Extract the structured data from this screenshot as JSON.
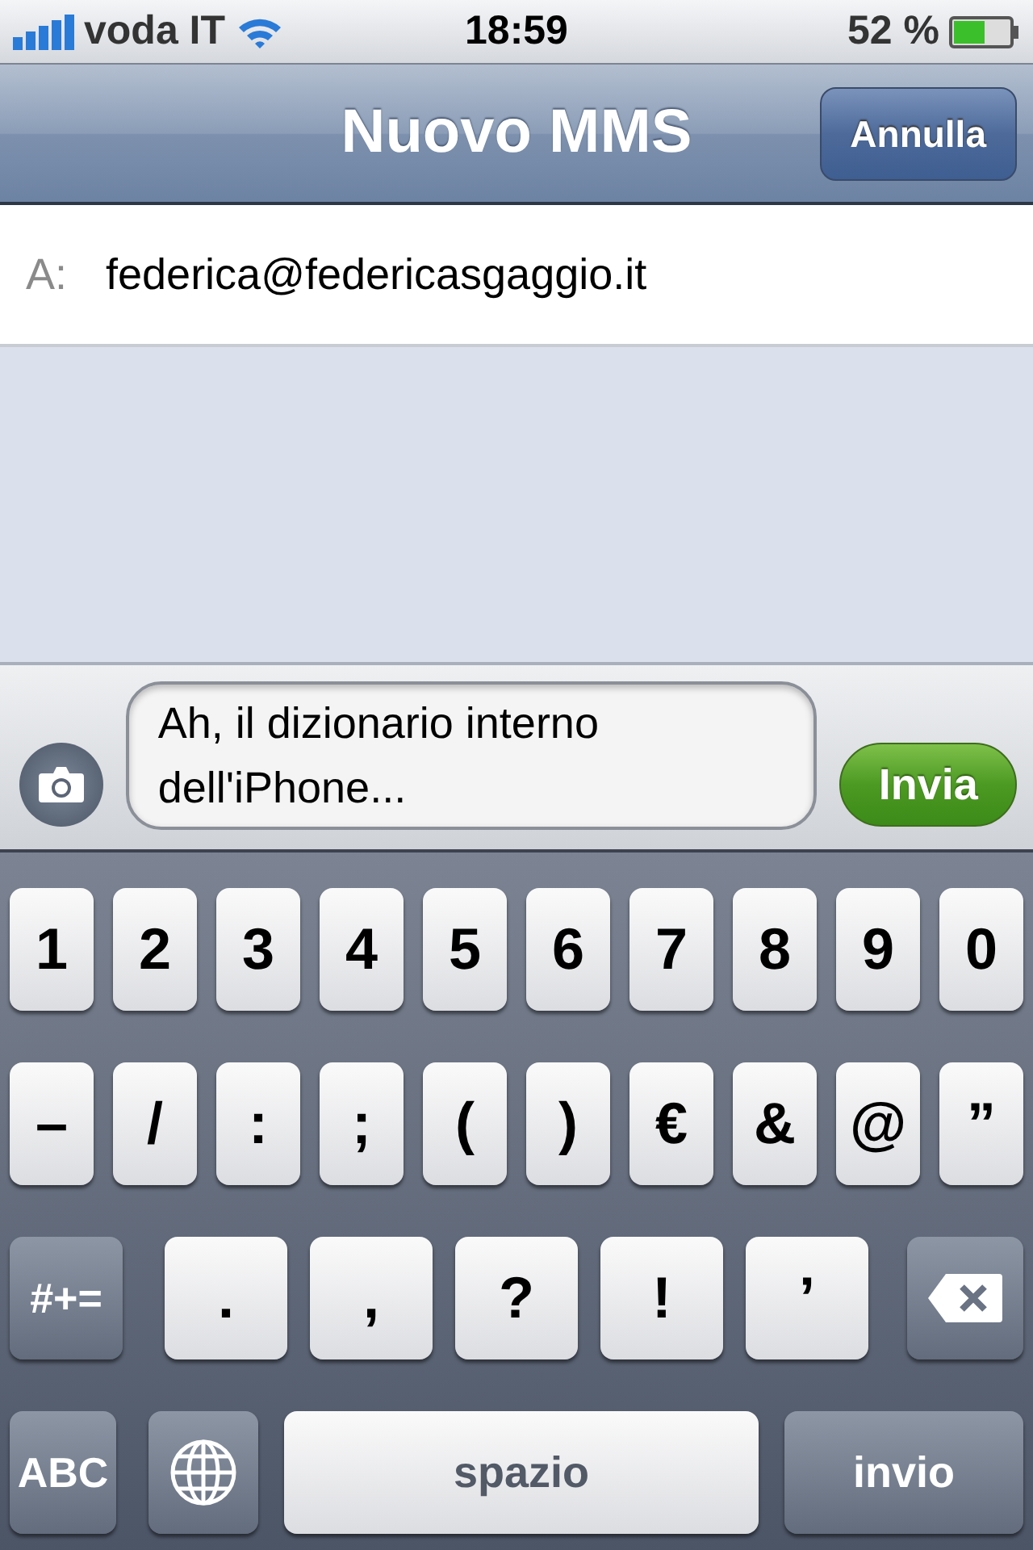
{
  "status_bar": {
    "carrier": "voda IT",
    "time": "18:59",
    "battery": "52 %"
  },
  "nav_bar": {
    "title": "Nuovo MMS",
    "cancel_button": "Annulla"
  },
  "recipient": {
    "label": "A:",
    "value": "federica@federicasgaggio.it"
  },
  "compose": {
    "message": "Ah, il dizionario interno dell'iPhone...",
    "send_button": "Invia"
  },
  "keyboard": {
    "rows": [
      {
        "keys": [
          {
            "kind": "char",
            "label": "1"
          },
          {
            "kind": "char",
            "label": "2"
          },
          {
            "kind": "char",
            "label": "3"
          },
          {
            "kind": "char",
            "label": "4"
          },
          {
            "kind": "char",
            "label": "5"
          },
          {
            "kind": "char",
            "label": "6"
          },
          {
            "kind": "char",
            "label": "7"
          },
          {
            "kind": "char",
            "label": "8"
          },
          {
            "kind": "char",
            "label": "9"
          },
          {
            "kind": "char",
            "label": "0"
          }
        ]
      },
      {
        "keys": [
          {
            "kind": "char",
            "label": "–"
          },
          {
            "kind": "char",
            "label": "/"
          },
          {
            "kind": "char",
            "label": ":"
          },
          {
            "kind": "char",
            "label": ";"
          },
          {
            "kind": "char",
            "label": "("
          },
          {
            "kind": "char",
            "label": ")"
          },
          {
            "kind": "char",
            "label": "€"
          },
          {
            "kind": "char",
            "label": "&"
          },
          {
            "kind": "char",
            "label": "@"
          },
          {
            "kind": "char",
            "label": "”"
          }
        ]
      },
      {
        "keys": [
          {
            "kind": "function",
            "label": "#+="
          },
          {
            "kind": "wide",
            "label": "."
          },
          {
            "kind": "wide",
            "label": ","
          },
          {
            "kind": "wide",
            "label": "?"
          },
          {
            "kind": "wide",
            "label": "!"
          },
          {
            "kind": "wide",
            "label": "’"
          },
          {
            "kind": "delete"
          }
        ]
      },
      {
        "keys": [
          {
            "kind": "function",
            "label": "ABC"
          },
          {
            "kind": "globe"
          },
          {
            "kind": "space",
            "label": "spazio"
          },
          {
            "kind": "return",
            "label": "invio"
          }
        ]
      }
    ]
  }
}
